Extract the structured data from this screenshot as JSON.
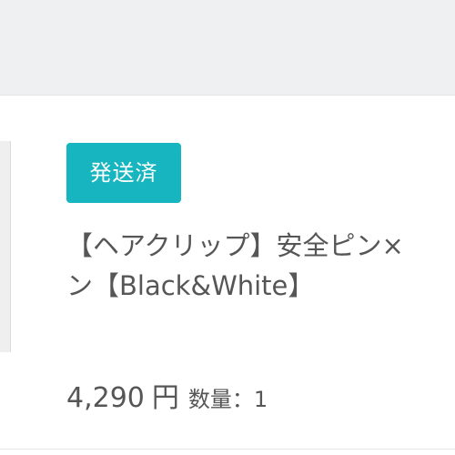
{
  "order": {
    "status_badge": "発送済",
    "title_line1": "【ヘアクリップ】安全ピン×",
    "title_line2": "ン【Black&White】",
    "price": "4,290",
    "currency": "円",
    "quantity_label": "数量：1"
  },
  "colors": {
    "badge_bg": "#17b5bf",
    "text": "#565656",
    "header_bg": "#eef0f2"
  }
}
